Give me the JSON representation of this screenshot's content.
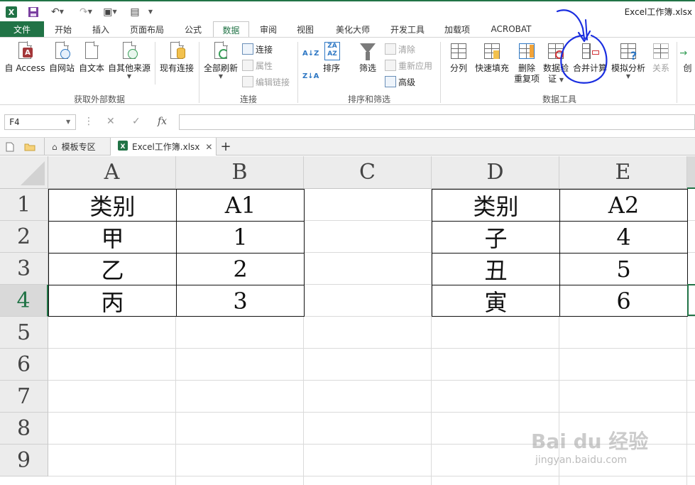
{
  "window": {
    "title": "Excel工作簿.xlsx"
  },
  "ribbon_tabs": {
    "file": "文件",
    "items": [
      "开始",
      "插入",
      "页面布局",
      "公式",
      "数据",
      "审阅",
      "视图",
      "美化大师",
      "开发工具",
      "加载项",
      "ACROBAT"
    ],
    "active": "数据"
  },
  "ribbon": {
    "get_external": {
      "label": "获取外部数据",
      "access": "自 Access",
      "web": "自网站",
      "text": "自文本",
      "other": "自其他来源",
      "existing": "现有连接"
    },
    "connections": {
      "label": "连接",
      "refresh_all": "全部刷新",
      "connections": "连接",
      "properties": "属性",
      "edit_links": "编辑链接"
    },
    "sort_filter": {
      "label": "排序和筛选",
      "sort": "排序",
      "filter": "筛选",
      "clear": "清除",
      "reapply": "重新应用",
      "advanced": "高级",
      "sort_az": "A↓Z",
      "sort_za": "Z↓A"
    },
    "data_tools": {
      "label": "数据工具",
      "text_to_columns": "分列",
      "flash_fill": "快速填充",
      "remove_dup_1": "删除",
      "remove_dup_2": "重复项",
      "validation_1": "数据验",
      "validation_2": "证",
      "consolidate": "合并计算",
      "what_if": "模拟分析",
      "relationships": "关系",
      "create": "创"
    }
  },
  "formula_bar": {
    "name_box": "F4",
    "cancel": "✕",
    "enter": "✓",
    "fx": "fx"
  },
  "workbook_tabs": {
    "template": "模板专区",
    "file": "Excel工作簿.xlsx",
    "add": "+"
  },
  "sheet": {
    "columns": [
      "A",
      "B",
      "C",
      "D",
      "E"
    ],
    "rows": [
      "1",
      "2",
      "3",
      "4",
      "5",
      "6",
      "7",
      "8",
      "9"
    ],
    "table1": {
      "header": [
        "类别",
        "A1"
      ],
      "rows": [
        [
          "甲",
          "1"
        ],
        [
          "乙",
          "2"
        ],
        [
          "丙",
          "3"
        ]
      ]
    },
    "table2": {
      "header": [
        "类别",
        "A2"
      ],
      "rows": [
        [
          "子",
          "4"
        ],
        [
          "丑",
          "5"
        ],
        [
          "寅",
          "6"
        ]
      ]
    }
  },
  "watermark": {
    "text": "Bai du 经验",
    "url": "jingyan.baidu.com"
  },
  "colors": {
    "accent": "#217346",
    "annotation": "#1a2ee0"
  }
}
